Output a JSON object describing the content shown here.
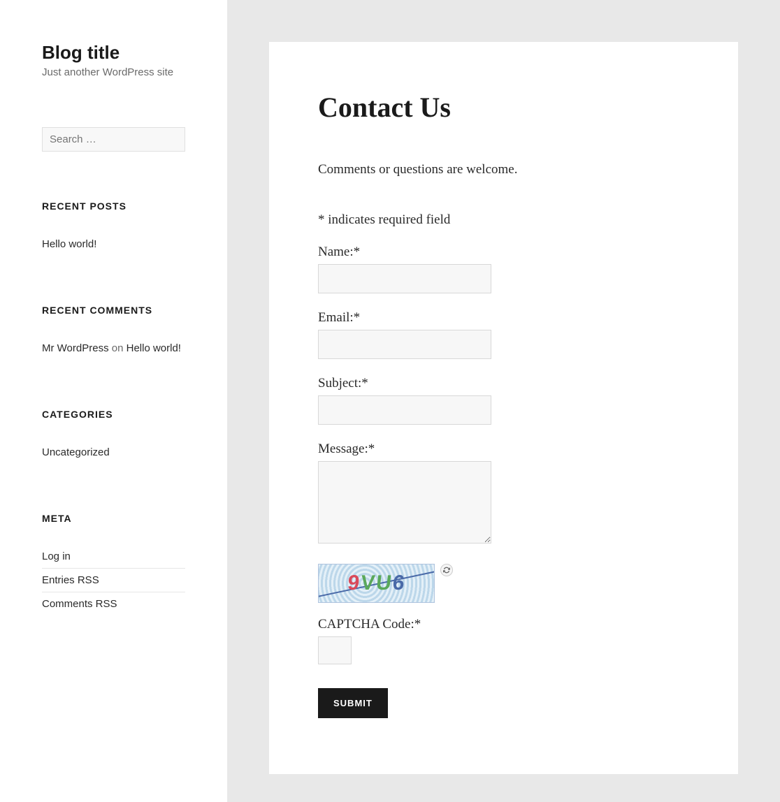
{
  "sidebar": {
    "site_title": "Blog title",
    "tagline": "Just another WordPress site",
    "search_placeholder": "Search …",
    "recent_posts": {
      "heading": "RECENT POSTS",
      "items": [
        "Hello world!"
      ]
    },
    "recent_comments": {
      "heading": "RECENT COMMENTS",
      "items": [
        {
          "author": "Mr WordPress",
          "connector": " on ",
          "post": "Hello world!"
        }
      ]
    },
    "categories": {
      "heading": "CATEGORIES",
      "items": [
        "Uncategorized"
      ]
    },
    "meta": {
      "heading": "META",
      "items": [
        "Log in",
        "Entries RSS",
        "Comments RSS"
      ]
    }
  },
  "page": {
    "title": "Contact Us",
    "intro": "Comments or questions are welcome.",
    "required_note": "* indicates required field",
    "form": {
      "name_label": "Name:*",
      "email_label": "Email:*",
      "subject_label": "Subject:*",
      "message_label": "Message:*",
      "captcha_label": "CAPTCHA Code:*",
      "captcha_value": "9VU6",
      "submit_label": "SUBMIT"
    }
  }
}
